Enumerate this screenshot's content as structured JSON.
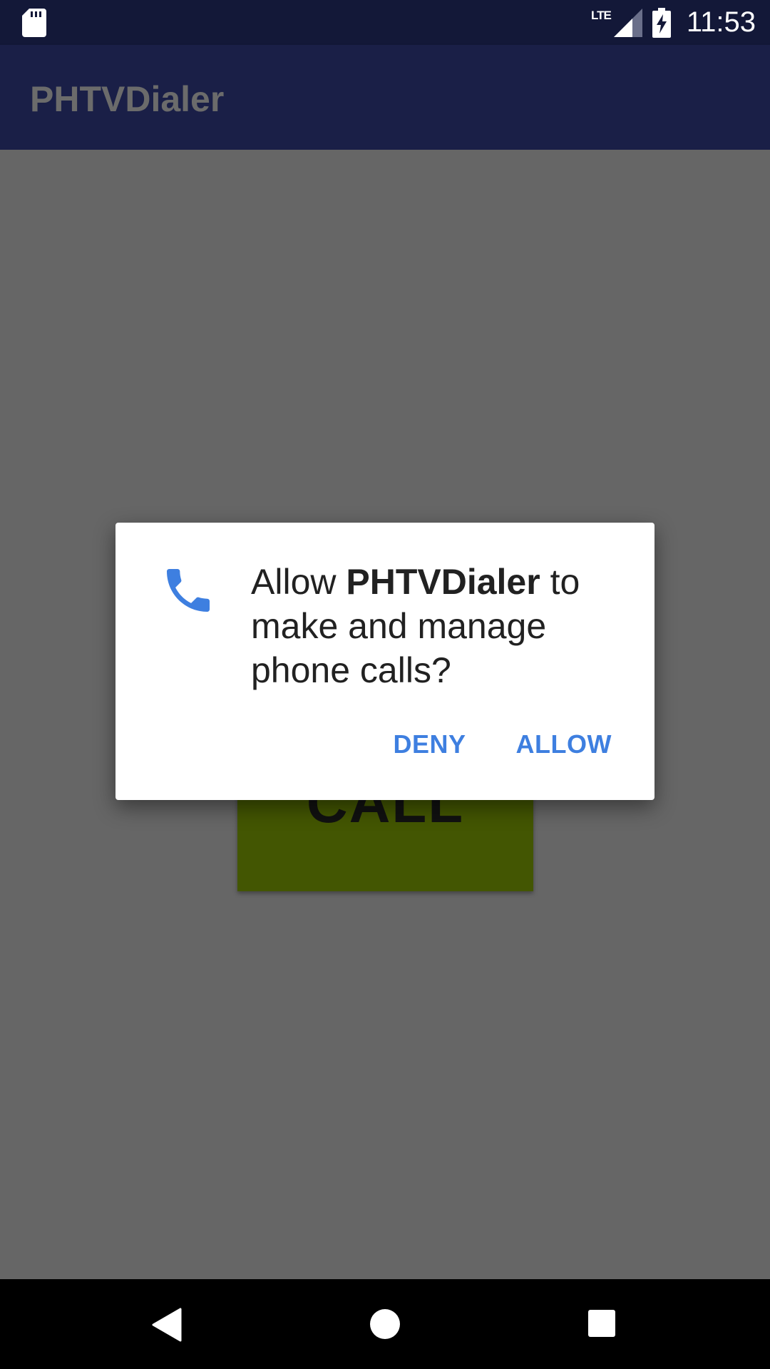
{
  "status_bar": {
    "network_label": "LTE",
    "time": "11:53",
    "icons": [
      "sd-card-icon",
      "signal-icon",
      "battery-charging-icon"
    ]
  },
  "app_bar": {
    "title": "PHTVDialer"
  },
  "main": {
    "call_button_label": "CALL"
  },
  "dialog": {
    "icon": "phone-icon",
    "message_prefix": "Allow ",
    "app_name": "PHTVDialer",
    "message_suffix": " to make and manage phone calls?",
    "deny_label": "DENY",
    "allow_label": "ALLOW"
  },
  "nav_bar": {
    "icons": [
      "back-icon",
      "home-icon",
      "recents-icon"
    ]
  },
  "colors": {
    "accent": "#3e7fe0",
    "app_bar": "#1a1f47",
    "status_bar": "#131838",
    "scrim_background": "#666666",
    "call_button": "#435602"
  }
}
